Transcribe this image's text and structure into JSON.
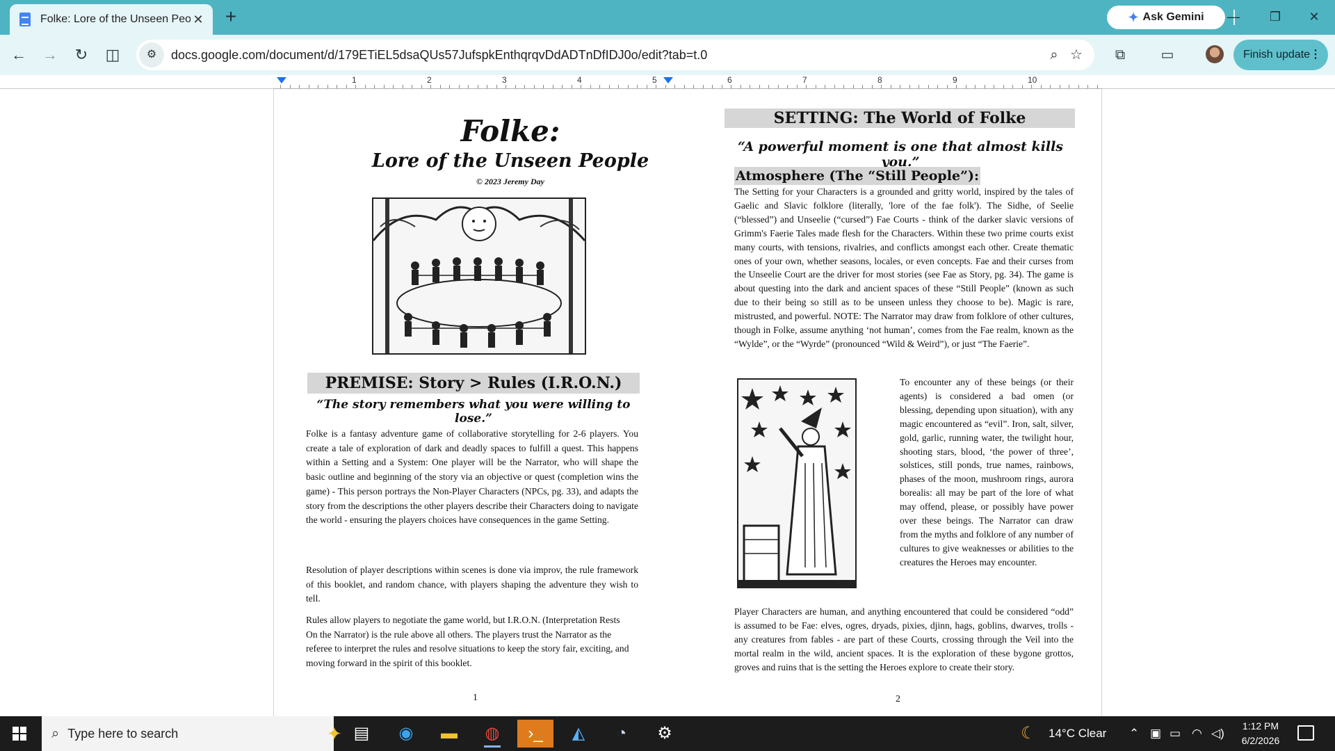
{
  "browser": {
    "tab_title": "Folke: Lore of the Unseen Peopl",
    "new_tab": "+",
    "ask_gemini": "Ask Gemini",
    "url": "docs.google.com/document/d/179ETiEL5dsaQUs57JufspkEnthqrqvDdADTnDfIDJ0o/edit?tab=t.0",
    "finish_update": "Finish update"
  },
  "ruler": {
    "numbers": [
      "1",
      "2",
      "3",
      "4",
      "5",
      "6",
      "7",
      "8",
      "9",
      "10"
    ]
  },
  "page1": {
    "title": "Folke:",
    "subtitle": "Lore of the Unseen People",
    "copyright": "© 2023 Jeremy Day",
    "premise_heading": "PREMISE: Story > Rules (I.R.O.N.)",
    "premise_quote": "“The story remembers what you were willing to lose.”",
    "para1": "Folke is a fantasy adventure game of collaborative storytelling for 2-6 players. You create a tale of exploration of dark and deadly spaces to fulfill a quest. This happens within a Setting and a System: One player will be the Narrator, who will shape the basic outline and beginning of the story via an objective or quest (completion wins the game) - This person portrays the Non-Player Characters (NPCs, pg. 33), and adapts the story from the descriptions the other players describe their Characters doing to navigate the world - ensuring the players choices have consequences in the game Setting.",
    "para2": "Resolution of player descriptions within scenes is done via improv, the rule framework of this booklet, and random chance, with players shaping the adventure they wish to tell.",
    "para3": "Rules allow players to negotiate the game world, but I.R.O.N. (Interpretation Rests On the Narrator) is the rule above all others. The players trust the Narrator as the referee to interpret the rules and resolve situations to keep the story fair, exciting, and moving forward in the spirit of this booklet.",
    "page_number": "1"
  },
  "page2": {
    "setting_heading": "SETTING: The World of Folke",
    "setting_quote": "“A powerful moment is one that almost kills you.”",
    "atmosphere_heading": "Atmosphere (The “Still People”):",
    "para1": "The Setting for your Characters is a grounded and gritty world, inspired by the tales of Gaelic and Slavic folklore (literally, 'lore of the fae folk'). The Sidhe, of Seelie (“blessed”) and Unseelie (“cursed”) Fae Courts - think of the darker slavic versions of Grimm's Faerie Tales made flesh for the Characters. Within these two prime courts exist many courts, with tensions, rivalries, and conflicts amongst each other. Create thematic ones of your own, whether seasons, locales, or even concepts. Fae and their curses from the Unseelie Court are the driver for most stories (see Fae as Story, pg. 34). The game is about questing into the dark and ancient spaces of these “Still People” (known as such due to their being so still as to be unseen unless they choose to be). Magic is rare, mistrusted, and powerful. NOTE: The Narrator may draw from folklore of other cultures, though in Folke, assume anything ‘not human’, comes from the Fae realm, known as the “Wylde”, or the “Wyrde” (pronounced “Wild & Weird”), or just “The Faerie”.",
    "para2": "To encounter any of these beings (or their agents) is considered a bad omen (or blessing, depending upon situation), with any magic encountered as “evil”. Iron, salt, silver, gold, garlic, running water, the twilight hour, shooting stars, blood, ‘the power of three’, solstices, still ponds, true names, rainbows, phases of the moon, mushroom rings, aurora borealis: all may be part of the lore of what may offend, please, or possibly have power over these beings. The Narrator can draw from the myths and folklore of any number of cultures to give weaknesses or abilities to the creatures the Heroes may encounter.",
    "para3": "Player Characters are human, and anything encountered that could be considered “odd” is assumed to be Fae: elves, ogres, dryads, pixies, djinn, hags, goblins, dwarves, trolls - any creatures from fables - are part of these Courts, crossing through the Veil into the mortal realm in the wild, ancient spaces. It is the exploration of these bygone grottos, groves and ruins that is the setting the Heroes explore to create their story.",
    "page_number": "2"
  },
  "taskbar": {
    "search_placeholder": "Type here to search",
    "weather": "14°C  Clear",
    "time": "1:12 PM",
    "date": "6/2/2026"
  }
}
